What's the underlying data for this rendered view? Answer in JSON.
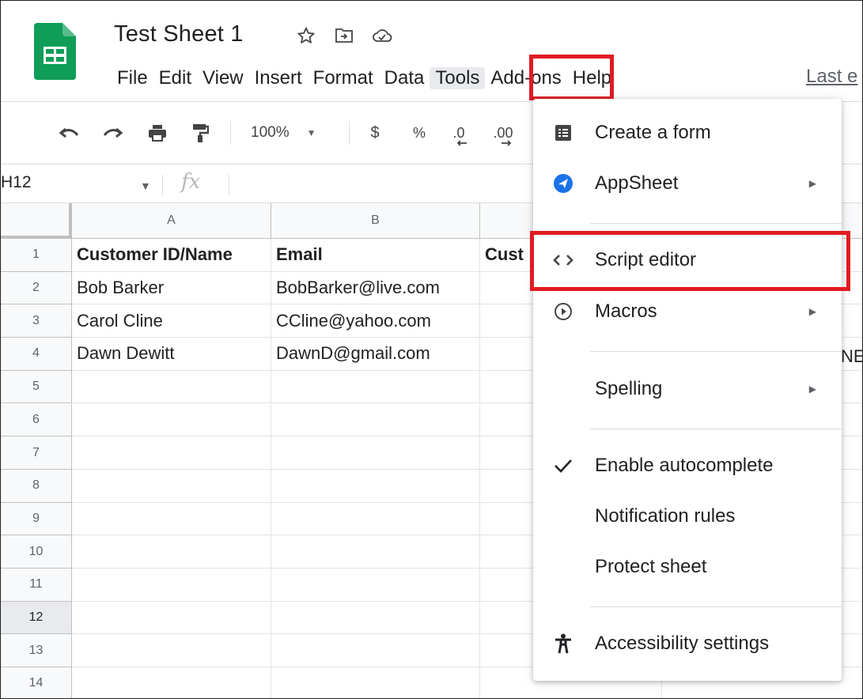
{
  "doc": {
    "title": "Test Sheet 1"
  },
  "menu": {
    "items": [
      "File",
      "Edit",
      "View",
      "Insert",
      "Format",
      "Data",
      "Tools",
      "Add-ons",
      "Help"
    ],
    "last_edit": "Last e"
  },
  "toolbar": {
    "zoom": "100%",
    "currency": "$",
    "percent": "%",
    "dec_decrease": ".0",
    "dec_increase": ".00"
  },
  "formula_bar": {
    "name_box": "H12",
    "fx": "fx"
  },
  "grid": {
    "columns": [
      "A",
      "B"
    ],
    "rows": [
      "1",
      "2",
      "3",
      "4",
      "5",
      "6",
      "7",
      "8",
      "9",
      "10",
      "11",
      "12",
      "13",
      "14"
    ],
    "selected_row": "12",
    "cells": [
      [
        "Customer ID/Name",
        "Email",
        "Cust"
      ],
      [
        "Bob Barker",
        "BobBarker@live.com",
        ""
      ],
      [
        "Carol Cline",
        "CCline@yahoo.com",
        ""
      ],
      [
        "Dawn Dewitt",
        "DawnD@gmail.com",
        ""
      ]
    ],
    "overflow_text": "NE"
  },
  "tools_menu": {
    "create_form": "Create a form",
    "appsheet": "AppSheet",
    "script_editor": "Script editor",
    "macros": "Macros",
    "spelling": "Spelling",
    "enable_autocomplete": "Enable autocomplete",
    "notification_rules": "Notification rules",
    "protect_sheet": "Protect sheet",
    "accessibility": "Accessibility settings"
  },
  "colors": {
    "sheets_green": "#0f9d58",
    "highlight_red": "#e11b22",
    "appsheet_blue": "#1a73e8"
  }
}
